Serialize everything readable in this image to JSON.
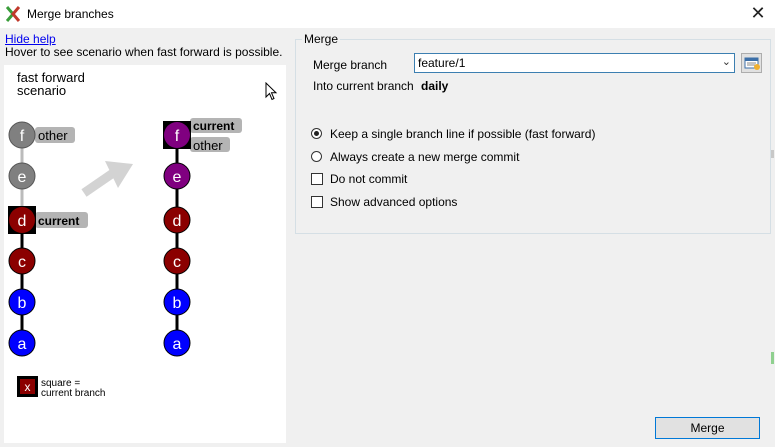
{
  "window": {
    "title": "Merge branches",
    "close_glyph": "✕"
  },
  "help": {
    "link": "Hide help",
    "hint": "Hover to see scenario when fast forward is possible."
  },
  "scenario": {
    "title_line1": "fast forward",
    "title_line2": "scenario",
    "legend_marker": "x",
    "legend_line1": "square =",
    "legend_line2": "current branch",
    "before": {
      "commits": [
        "f",
        "e",
        "d",
        "c",
        "b",
        "a"
      ],
      "labels": {
        "f": "other",
        "d": "current"
      }
    },
    "after": {
      "commits": [
        "f",
        "e",
        "d",
        "c",
        "b",
        "a"
      ],
      "labels": {
        "f_top": "current",
        "f_bottom": "other"
      }
    },
    "colors": {
      "gray": "#808080",
      "dark_red": "#8b0000",
      "blue": "#0000ff",
      "purple": "#800080",
      "arrow": "#d3d3d3"
    }
  },
  "merge": {
    "group_title": "Merge",
    "merge_branch_label": "Merge branch",
    "merge_branch_value": "feature/1",
    "into_label": "Into current branch",
    "into_value": "daily",
    "options": [
      {
        "label": "Keep a single branch line if possible (fast forward)",
        "type": "radio",
        "checked": true
      },
      {
        "label": "Always create a new merge commit",
        "type": "radio",
        "checked": false
      },
      {
        "label": "Do not commit",
        "type": "checkbox",
        "checked": false
      },
      {
        "label": "Show advanced options",
        "type": "checkbox",
        "checked": false
      }
    ],
    "button": "Merge"
  }
}
